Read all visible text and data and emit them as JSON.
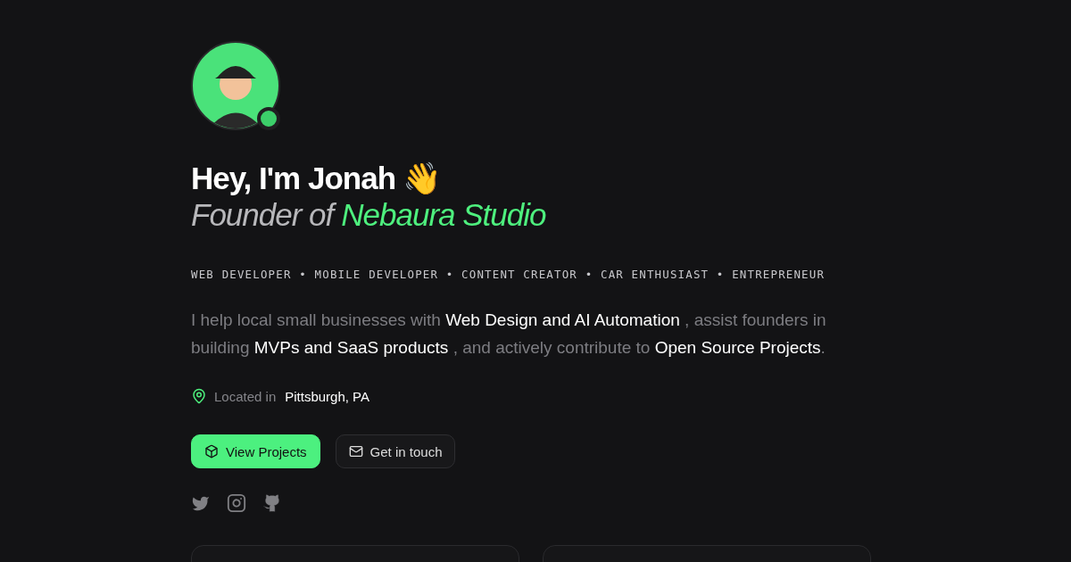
{
  "profile": {
    "online": true
  },
  "greeting": "Hey, I'm Jonah",
  "greeting_emoji": "👋",
  "subtitle": {
    "prefix": "Founder of",
    "highlight": "Nebaura Studio"
  },
  "roles": "WEB DEVELOPER • MOBILE DEVELOPER • CONTENT CREATOR • CAR ENTHUSIAST • ENTREPRENEUR",
  "bio": "I help local small businesses with **Web Design and AI Automation** , assist founders in building **MVPs and SaaS products** , and actively contribute to **Open Source Projects**.",
  "location": {
    "label": "Located in",
    "value": "Pittsburgh, PA"
  },
  "buttons": [
    {
      "label": "View Projects",
      "kind": "primary"
    },
    {
      "label": "Get in touch",
      "kind": "secondary"
    }
  ],
  "socials": [
    {
      "kind": "twitter"
    },
    {
      "kind": "instagram"
    },
    {
      "kind": "github"
    }
  ]
}
